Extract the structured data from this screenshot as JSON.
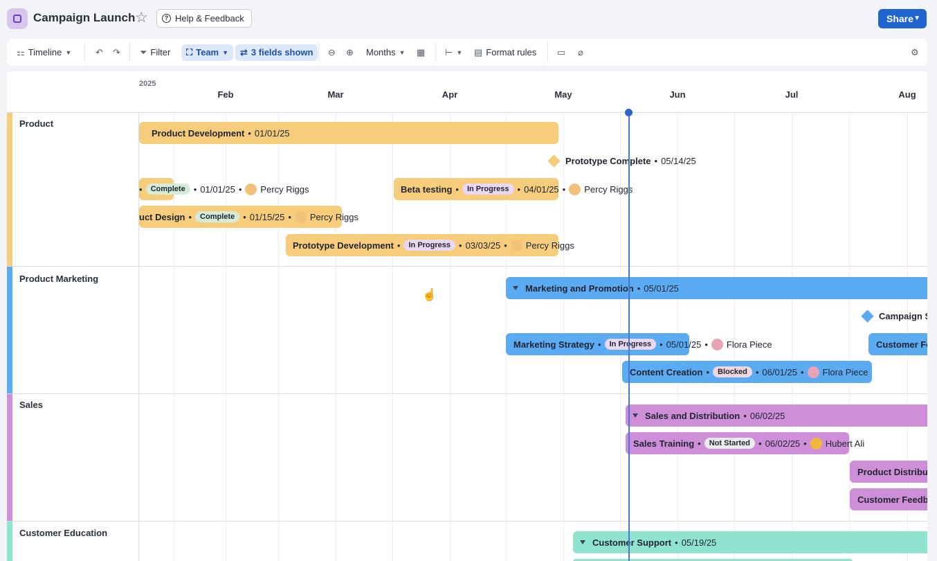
{
  "header": {
    "title": "Campaign Launch",
    "help_label": "Help & Feedback",
    "share_label": "Share"
  },
  "toolbar": {
    "timeline_label": "Timeline",
    "filter_label": "Filter",
    "team_label": "Team",
    "fields_label": "3 fields shown",
    "months_label": "Months",
    "format_rules_label": "Format rules"
  },
  "timeline": {
    "year": "2025",
    "months": [
      "Feb",
      "Mar",
      "Apr",
      "May",
      "Jun",
      "Jul",
      "Aug"
    ]
  },
  "colors": {
    "product": "#f7cd7b",
    "product_marketing": "#5aabf2",
    "sales": "#cf8fd8",
    "customer_education": "#8fe3cf",
    "today_line": "#4677d1"
  },
  "lanes": [
    {
      "name": "Product",
      "items": [
        {
          "title": "Product Development",
          "date": "01/01/25"
        },
        {
          "title": "Prototype Complete",
          "date": "05/14/25"
        },
        {
          "status": "Complete",
          "date": "01/01/25",
          "assignee": "Percy Riggs"
        },
        {
          "title": "Beta testing",
          "status": "In Progress",
          "date": "04/01/25",
          "assignee": "Percy Riggs"
        },
        {
          "title": "uct Design",
          "status": "Complete",
          "date": "01/15/25",
          "assignee": "Percy Riggs"
        },
        {
          "title": "Prototype Development",
          "status": "In Progress",
          "date": "03/03/25",
          "assignee": "Percy Riggs"
        }
      ]
    },
    {
      "name": "Product Marketing",
      "items": [
        {
          "title": "Marketing and Promotion",
          "date": "05/01/25"
        },
        {
          "title": "Campaign S"
        },
        {
          "title": "Marketing Strategy",
          "status": "In Progress",
          "date": "05/01/25",
          "assignee": "Flora Piece"
        },
        {
          "title": "Customer Fe"
        },
        {
          "title": "Content Creation",
          "status": "Blocked",
          "date": "06/01/25",
          "assignee": "Flora Piece"
        }
      ]
    },
    {
      "name": "Sales",
      "items": [
        {
          "title": "Sales and Distribution",
          "date": "06/02/25"
        },
        {
          "title": "Sales Training",
          "status": "Not Started",
          "date": "06/02/25",
          "assignee": "Hubert Ali"
        },
        {
          "title": "Product Distribut"
        },
        {
          "title": "Customer Feedb"
        }
      ]
    },
    {
      "name": "Customer Education",
      "items": [
        {
          "title": "Customer Support",
          "date": "05/19/25"
        }
      ]
    }
  ]
}
